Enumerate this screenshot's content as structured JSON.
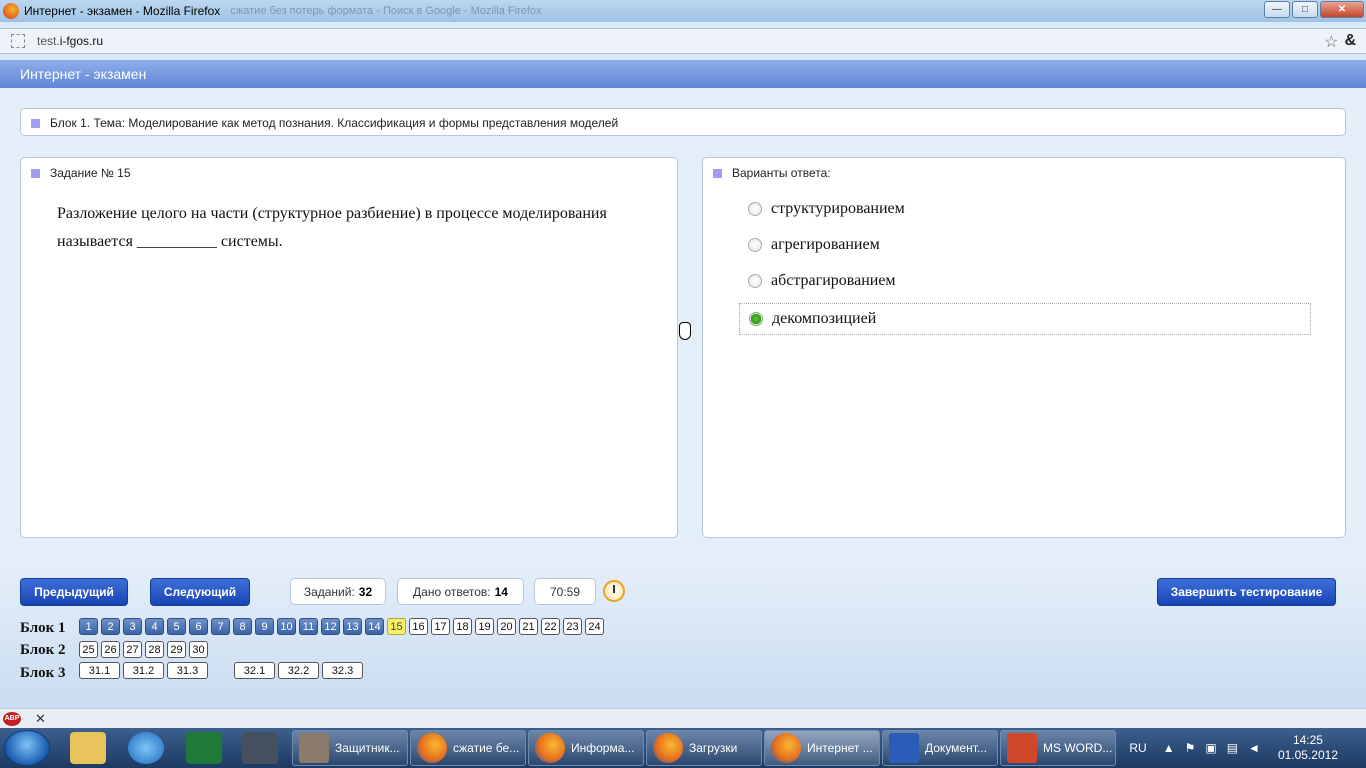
{
  "window": {
    "title": "Интернет - экзамен - Mozilla Firefox",
    "ghost_title": "сжатие без потерь формата - Поиск в Google - Mozilla Firefox",
    "min_glyph": "—",
    "max_glyph": "□",
    "close_glyph": "✕"
  },
  "addressbar": {
    "url_prefix": "test.",
    "url_domain": "i-fgos.ru",
    "bookmark_glyph": "☆",
    "addon_glyph": "&"
  },
  "site": {
    "header": "Интернет - экзамен"
  },
  "block_title": "Блок 1. Тема: Моделирование как метод познания. Классификация и формы представления моделей",
  "task": {
    "label": "Задание № 15",
    "question": "Разложение целого на части (структурное разбиение) в процессе моделирования называется __________ системы."
  },
  "answers": {
    "label": "Варианты ответа:",
    "options": [
      {
        "text": "структурированием",
        "selected": false
      },
      {
        "text": "агрегированием",
        "selected": false
      },
      {
        "text": "абстрагированием",
        "selected": false
      },
      {
        "text": "декомпозицией",
        "selected": true
      }
    ]
  },
  "controls": {
    "prev": "Предыдущий",
    "next": "Следующий",
    "tasks_label": "Заданий:",
    "tasks_count": "32",
    "answered_label": "Дано ответов:",
    "answered_count": "14",
    "timer": "70:59",
    "finish": "Завершить тестирование"
  },
  "navigation": {
    "blocks": [
      {
        "label": "Блок 1",
        "items": [
          "1",
          "2",
          "3",
          "4",
          "5",
          "6",
          "7",
          "8",
          "9",
          "10",
          "11",
          "12",
          "13",
          "14",
          "15",
          "16",
          "17",
          "18",
          "19",
          "20",
          "21",
          "22",
          "23",
          "24"
        ],
        "answered_through": 14,
        "current": "15"
      },
      {
        "label": "Блок 2",
        "items": [
          "25",
          "26",
          "27",
          "28",
          "29",
          "30"
        ]
      },
      {
        "label": "Блок 3",
        "items": [
          "31.1",
          "31.2",
          "31.3",
          "32.1",
          "32.2",
          "32.3"
        ]
      }
    ]
  },
  "addonbar": {
    "abp": "ABP",
    "close": "✕"
  },
  "taskbar": {
    "tasks": [
      "Защитник...",
      "сжатие бе...",
      "Информа...",
      "Загрузки",
      "Интернет ...",
      "Документ...",
      "MS WORD..."
    ],
    "language": "RU",
    "time": "14:25",
    "date": "01.05.2012"
  }
}
